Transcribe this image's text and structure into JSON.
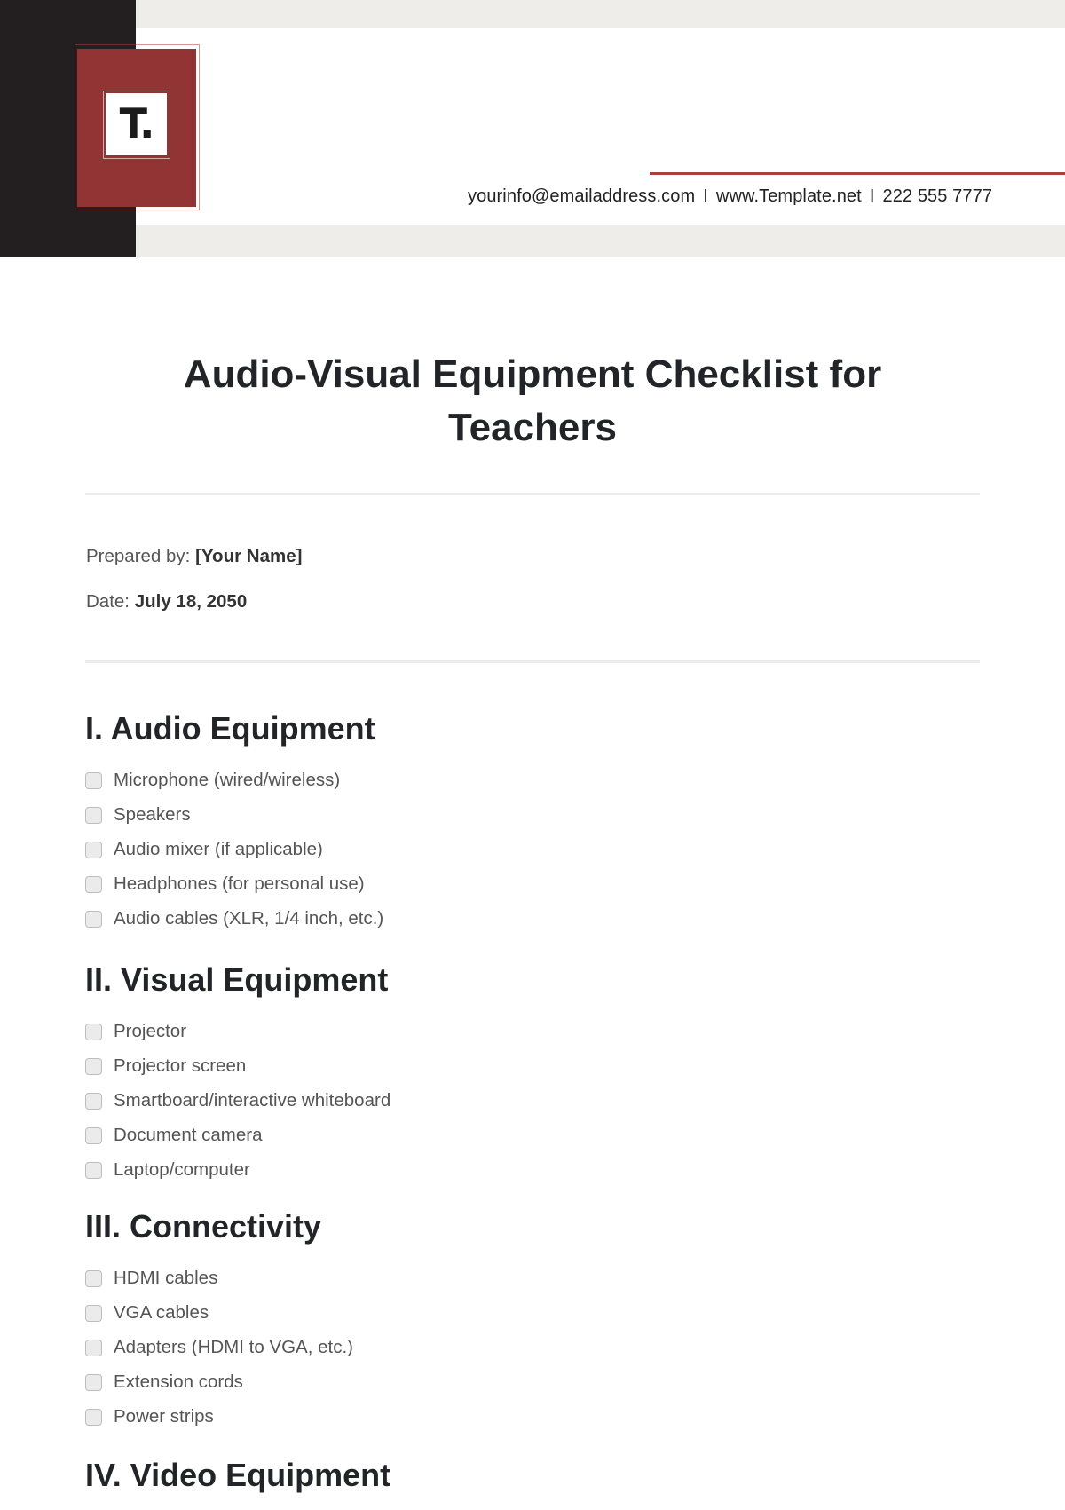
{
  "header": {
    "logo_text": "T.",
    "contact": {
      "email": "yourinfo@emailaddress.com",
      "separator": "I",
      "website": "www.Template.net",
      "phone": "222 555 7777"
    }
  },
  "document": {
    "title_line1": "Audio-Visual Equipment Checklist for",
    "title_line2": "Teachers",
    "prepared_by_label": "Prepared by:",
    "prepared_by_value": "[Your Name]",
    "date_label": "Date:",
    "date_value": "July 18, 2050"
  },
  "sections": [
    {
      "heading": "I. Audio Equipment",
      "items": [
        {
          "label": "Microphone (wired/wireless)",
          "checked": false
        },
        {
          "label": "Speakers",
          "checked": false
        },
        {
          "label": "Audio mixer (if applicable)",
          "checked": false
        },
        {
          "label": "Headphones (for personal use)",
          "checked": false
        },
        {
          "label": "Audio cables (XLR, 1/4 inch, etc.)",
          "checked": false
        }
      ]
    },
    {
      "heading": "II. Visual Equipment",
      "items": [
        {
          "label": "Projector",
          "checked": false
        },
        {
          "label": "Projector screen",
          "checked": false
        },
        {
          "label": "Smartboard/interactive whiteboard",
          "checked": false
        },
        {
          "label": "Document camera",
          "checked": false
        },
        {
          "label": "Laptop/computer",
          "checked": false
        }
      ]
    },
    {
      "heading": "III. Connectivity",
      "items": [
        {
          "label": "HDMI cables",
          "checked": false
        },
        {
          "label": "VGA cables",
          "checked": false
        },
        {
          "label": "Adapters (HDMI to VGA, etc.)",
          "checked": false
        },
        {
          "label": "Extension cords",
          "checked": false
        },
        {
          "label": "Power strips",
          "checked": false
        }
      ]
    },
    {
      "heading": "IV. Video Equipment",
      "items": []
    }
  ],
  "colors": {
    "accent_red": "#913433",
    "sidebar_dark": "#231f20",
    "band_gray": "#eeedea"
  }
}
